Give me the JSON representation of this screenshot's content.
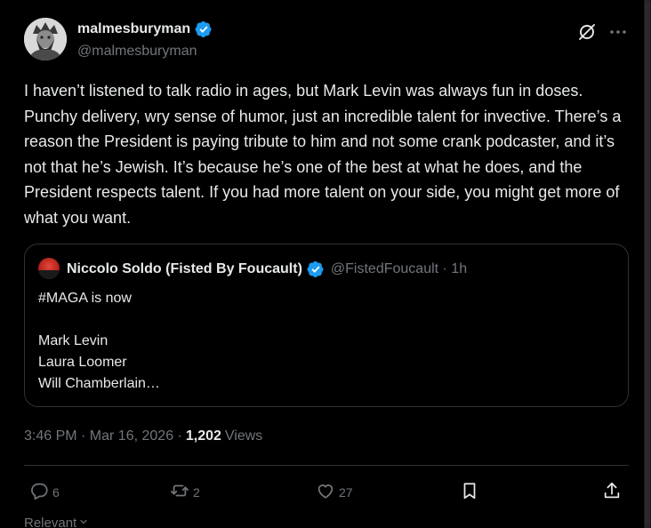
{
  "author": {
    "display_name": "malmesburyman",
    "handle": "@malmesburyman",
    "verified": true
  },
  "tweet": {
    "text": "I haven’t listened to talk radio in ages, but Mark Levin was always fun in doses. Punchy delivery, wry sense of humor, just an incredible talent for invective. There’s a reason the President is paying tribute to him and not some crank podcaster, and it’s not that he’s Jewish. It’s because he’s one of the best at what he does, and the President respects talent. If you had more talent on your side, you might get more of what you want."
  },
  "quoted_tweet": {
    "display_name": "Niccolo Soldo (Fisted By Foucault)",
    "handle_time": "@FistedFoucault · 1h",
    "text": "#MAGA is now\n\nMark Levin\nLaura Loomer\nWill Chamberlain…"
  },
  "meta": {
    "timestamp": "3:46 PM · Mar 16, 2026 ·",
    "views_count": "1,202",
    "views_label": "Views"
  },
  "actions": {
    "replies": "6",
    "reposts": "2",
    "likes": "27"
  },
  "sort": {
    "label": "Relevant"
  },
  "icons": {
    "verified": "verified-badge-icon",
    "grok": "grok-icon",
    "more": "more-icon",
    "reply": "reply-icon",
    "repost": "repost-icon",
    "like": "like-icon",
    "bookmark": "bookmark-icon",
    "share": "share-icon",
    "chevron": "chevron-down-icon"
  },
  "colors": {
    "background": "#000000",
    "text": "#e7e9ea",
    "secondary": "#71767b",
    "verified": "#1d9bf0",
    "border": "#2f3336"
  }
}
